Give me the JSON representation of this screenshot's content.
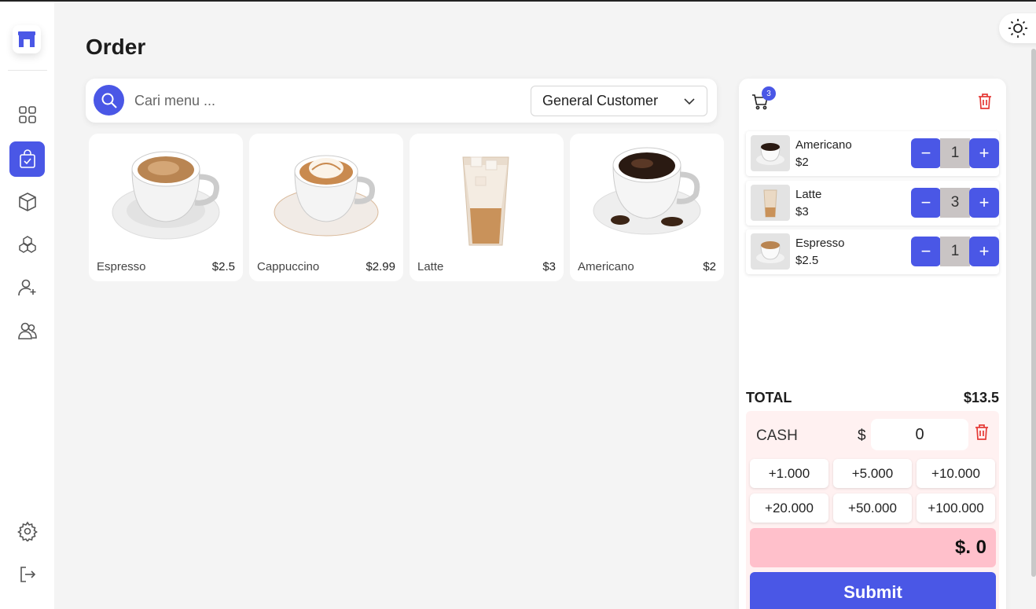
{
  "page": {
    "title": "Order"
  },
  "sidebar": {
    "items": [
      {
        "name": "dashboard",
        "icon": "grid-icon"
      },
      {
        "name": "order",
        "icon": "shopping-bag-icon",
        "active": true
      },
      {
        "name": "products",
        "icon": "box-icon"
      },
      {
        "name": "categories",
        "icon": "cubes-icon"
      },
      {
        "name": "add-user",
        "icon": "user-plus-icon"
      },
      {
        "name": "users",
        "icon": "users-icon"
      },
      {
        "name": "settings",
        "icon": "gear-icon"
      },
      {
        "name": "logout",
        "icon": "logout-icon"
      }
    ],
    "accent": "#4a57e6"
  },
  "search": {
    "placeholder": "Cari menu ..."
  },
  "customer_select": {
    "value": "General Customer"
  },
  "products": [
    {
      "name": "Espresso",
      "price": "$2.5"
    },
    {
      "name": "Cappuccino",
      "price": "$2.99"
    },
    {
      "name": "Latte",
      "price": "$3"
    },
    {
      "name": "Americano",
      "price": "$2"
    }
  ],
  "cart": {
    "badge": "3",
    "items": [
      {
        "name": "Americano",
        "price": "$2",
        "qty": "1"
      },
      {
        "name": "Latte",
        "price": "$3",
        "qty": "3"
      },
      {
        "name": "Espresso",
        "price": "$2.5",
        "qty": "1"
      }
    ],
    "total_label": "TOTAL",
    "total_value": "$13.5"
  },
  "payment": {
    "method": "CASH",
    "currency": "$",
    "amount": "0",
    "quick_amounts": [
      "+1.000",
      "+5.000",
      "+10.000",
      "+20.000",
      "+50.000",
      "+100.000"
    ],
    "change": "$. 0",
    "submit_label": "Submit"
  },
  "colors": {
    "primary": "#4a57e6",
    "danger": "#e53935",
    "change_bg": "#ffc0cb"
  }
}
